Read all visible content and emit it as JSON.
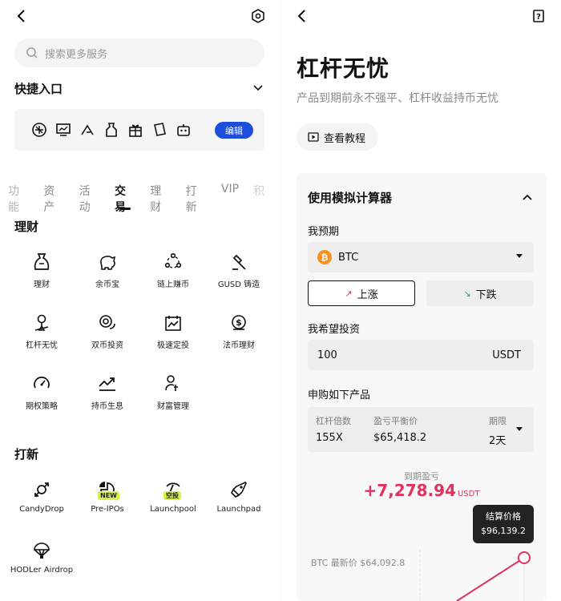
{
  "left": {
    "search_placeholder": "搜索更多服务",
    "quick_entry_title": "快捷入口",
    "quick_icons": [
      "gift-box-icon",
      "chart-icon",
      "arrow-icon",
      "bag-icon",
      "gift-icon",
      "cards-icon",
      "robot-icon"
    ],
    "edit_label": "编辑",
    "tabs": [
      "功能",
      "资产",
      "活动",
      "交易",
      "理财",
      "打新",
      "VIP",
      "积"
    ],
    "active_tab": "交易",
    "finance_title": "理财",
    "finance_items": [
      {
        "label": "理财",
        "icon": "money-bag-icon"
      },
      {
        "label": "余币宝",
        "icon": "piggy-bank-icon"
      },
      {
        "label": "链上赚币",
        "icon": "chain-nodes-icon"
      },
      {
        "label": "GUSD 铸造",
        "icon": "hammer-icon"
      },
      {
        "label": "杠杆无忧",
        "icon": "lever-icon"
      },
      {
        "label": "双币投资",
        "icon": "dual-coin-icon"
      },
      {
        "label": "极速定投",
        "icon": "calendar-chart-icon"
      },
      {
        "label": "法币理财",
        "icon": "dollar-coin-icon"
      },
      {
        "label": "期权策略",
        "icon": "gauge-icon"
      },
      {
        "label": "持币生息",
        "icon": "growth-icon"
      },
      {
        "label": "财富管理",
        "icon": "person-money-icon"
      }
    ],
    "launch_title": "打新",
    "launch_items": [
      {
        "label": "CandyDrop",
        "icon": "candy-icon",
        "tag": ""
      },
      {
        "label": "Pre-IPOs",
        "icon": "pie-icon",
        "tag": "NEW"
      },
      {
        "label": "Launchpool",
        "icon": "pickaxe-icon",
        "tag": "空投"
      },
      {
        "label": "Launchpad",
        "icon": "rocket-icon",
        "tag": ""
      },
      {
        "label": "HODLer Airdrop",
        "icon": "parachute-icon",
        "tag": ""
      }
    ]
  },
  "right": {
    "title": "杠杆无忧",
    "subtitle": "产品到期前永不强平、杠杆收益持币无忧",
    "tutorial_label": "查看教程",
    "calculator_title": "使用模拟计算器",
    "expect_label": "我预期",
    "coin": "BTC",
    "coin_symbol": "₿",
    "up_label": "上涨",
    "down_label": "下跌",
    "invest_label": "我希望投资",
    "amount": "100",
    "amount_unit": "USDT",
    "subscribe_label": "申购如下产品",
    "product": {
      "leverage_label": "杠杆倍数",
      "leverage_value": "155X",
      "breakeven_label": "盈亏平衡价",
      "breakeven_value": "$65,418.2",
      "term_label": "期限",
      "term_value": "2天"
    },
    "pnl_label": "到期盈亏",
    "pnl_value": "+7,278.94",
    "pnl_unit": "USDT",
    "settle_label": "结算价格",
    "settle_value": "$96,139.2",
    "latest_price": "BTC 最新价 $64,092.8"
  },
  "colors": {
    "accent_blue": "#1d4fdc",
    "pnl_red": "#e0325d",
    "btc_orange": "#f39322",
    "up_red": "#e0325d",
    "down_green": "#19a37a"
  }
}
